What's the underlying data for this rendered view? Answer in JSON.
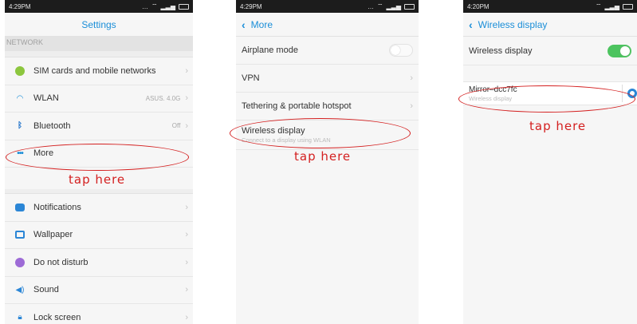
{
  "phone1": {
    "time": "4:29PM",
    "title": "Settings",
    "section": "NETWORK",
    "items": [
      {
        "label": "SIM cards and mobile networks",
        "value": ""
      },
      {
        "label": "WLAN",
        "value": "ASUS. 4.0G"
      },
      {
        "label": "Bluetooth",
        "value": "Off"
      },
      {
        "label": "More",
        "value": ""
      },
      {
        "label": "Notifications",
        "value": ""
      },
      {
        "label": "Wallpaper",
        "value": ""
      },
      {
        "label": "Do not disturb",
        "value": ""
      },
      {
        "label": "Sound",
        "value": ""
      },
      {
        "label": "Lock screen",
        "value": ""
      }
    ],
    "annotation": "tap here"
  },
  "phone2": {
    "time": "4:29PM",
    "title": "More",
    "items": [
      {
        "label": "Airplane mode",
        "toggle": false
      },
      {
        "label": "VPN"
      },
      {
        "label": "Tethering & portable hotspot"
      },
      {
        "label": "Wireless display",
        "sub": "Connect to a display using WLAN"
      }
    ],
    "annotation": "tap here"
  },
  "phone3": {
    "time": "4:20PM",
    "title": "Wireless display",
    "toggle_label": "Wireless display",
    "toggle_on": true,
    "device": {
      "name": "Mirror–dcc7fc",
      "sub": "Wireless display"
    },
    "annotation": "tap here"
  },
  "colors": {
    "accent": "#1a8ed8",
    "annotation": "#d42020",
    "toggle_on": "#4cc45f"
  }
}
